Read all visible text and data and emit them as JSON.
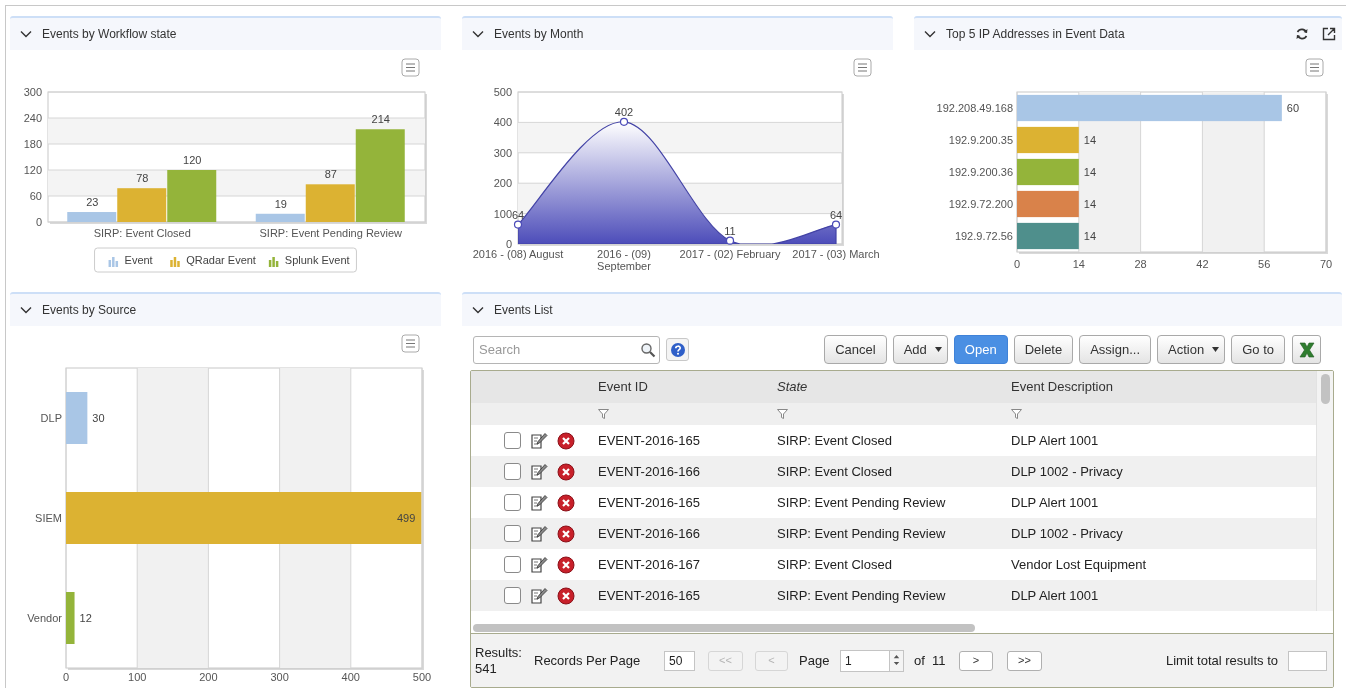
{
  "panels": [
    {
      "title": "Events by Workflow state",
      "has_actions": false,
      "chart_data": {
        "type": "bar",
        "categories": [
          "SIRP: Event Closed",
          "SIRP: Event Pending Review"
        ],
        "series": [
          {
            "name": "Event",
            "color": "#a9c6e6",
            "values": [
              23,
              19
            ]
          },
          {
            "name": "QRadar Event",
            "color": "#dcb232",
            "values": [
              78,
              87
            ]
          },
          {
            "name": "Splunk Event",
            "color": "#94b43a",
            "values": [
              120,
              214
            ]
          }
        ],
        "ylim": [
          0,
          300
        ],
        "yticks": [
          0,
          60,
          120,
          180,
          240,
          300
        ],
        "data_labels": true,
        "grid": true,
        "legend": "bottom"
      }
    },
    {
      "title": "Events by Month",
      "has_actions": false,
      "chart_data": {
        "type": "area",
        "categories": [
          "2016 - (08) August",
          "2016 - (09) September",
          "2017 - (02) February",
          "2017 - (03) March"
        ],
        "series": [
          {
            "color": "#4a4ab8",
            "values": [
              64,
              402,
              11,
              64
            ]
          }
        ],
        "ylim": [
          0,
          500
        ],
        "yticks": [
          0,
          100,
          200,
          300,
          400,
          500
        ],
        "data_labels": true,
        "grid": true
      }
    },
    {
      "title": "Top 5 IP Addresses in Event Data",
      "has_actions": true,
      "chart_data": {
        "type": "bar",
        "orientation": "horizontal",
        "categories": [
          "192.208.49.168",
          "192.9.200.35",
          "192.9.200.36",
          "192.9.72.200",
          "192.9.72.56"
        ],
        "series": [
          {
            "color": "#a9c6e6",
            "values": [
              60,
              null,
              null,
              null,
              null
            ]
          },
          {
            "color": "#dcb232",
            "values": [
              null,
              14,
              null,
              null,
              null
            ]
          },
          {
            "color": "#94b43a",
            "values": [
              null,
              null,
              14,
              null,
              null
            ]
          },
          {
            "color": "#d9824a",
            "values": [
              null,
              null,
              null,
              14,
              null
            ]
          },
          {
            "color": "#4f8f8c",
            "values": [
              null,
              null,
              null,
              null,
              14
            ]
          }
        ],
        "xlim": [
          0,
          70
        ],
        "xticks": [
          0,
          14,
          28,
          42,
          56,
          70
        ],
        "data_labels": true,
        "grid": true
      }
    },
    {
      "title": "Events by Source",
      "has_actions": false,
      "chart_data": {
        "type": "bar",
        "orientation": "horizontal",
        "categories": [
          "DLP",
          "SIEM",
          "Vendor"
        ],
        "series": [
          {
            "color": "#a9c6e6",
            "values": [
              30,
              null,
              null
            ]
          },
          {
            "color": "#dcb232",
            "values": [
              null,
              499,
              null
            ]
          },
          {
            "color": "#94b43a",
            "values": [
              null,
              null,
              12
            ]
          }
        ],
        "xlim": [
          0,
          500
        ],
        "xticks": [
          0,
          100,
          200,
          300,
          400,
          500
        ],
        "data_labels": true,
        "grid": true
      }
    }
  ],
  "events_list": {
    "title": "Events List",
    "search": {
      "placeholder": "Search"
    },
    "buttons": [
      {
        "label": "Cancel",
        "kind": "plain"
      },
      {
        "label": "Add",
        "kind": "dropdown"
      },
      {
        "label": "Open",
        "kind": "primary"
      },
      {
        "label": "Delete",
        "kind": "plain"
      },
      {
        "label": "Assign...",
        "kind": "plain"
      },
      {
        "label": "Action",
        "kind": "dropdown"
      },
      {
        "label": "Go to",
        "kind": "plain"
      }
    ],
    "columns": [
      {
        "label": "Event ID",
        "italic": false
      },
      {
        "label": "State",
        "italic": true
      },
      {
        "label": "Event Description",
        "italic": false
      }
    ],
    "rows": [
      {
        "checked": false,
        "event_id": "EVENT-2016-165",
        "state": "SIRP: Event Closed",
        "description": "DLP Alert 1001"
      },
      {
        "checked": false,
        "event_id": "EVENT-2016-166",
        "state": "SIRP: Event Closed",
        "description": "DLP 1002 - Privacy"
      },
      {
        "checked": false,
        "event_id": "EVENT-2016-165",
        "state": "SIRP: Event Pending Review",
        "description": "DLP Alert 1001"
      },
      {
        "checked": false,
        "event_id": "EVENT-2016-166",
        "state": "SIRP: Event Pending Review",
        "description": "DLP 1002 - Privacy"
      },
      {
        "checked": false,
        "event_id": "EVENT-2016-167",
        "state": "SIRP: Event Closed",
        "description": "Vendor Lost Equipment"
      },
      {
        "checked": false,
        "event_id": "EVENT-2016-165",
        "state": "SIRP: Event Pending Review",
        "description": "DLP Alert 1001"
      }
    ],
    "footer": {
      "results_label": "Results:",
      "results_count": "541",
      "records_label": "Records Per Page",
      "records_value": "50",
      "first": {
        "label": "<<",
        "disabled": true
      },
      "prev": {
        "label": "<",
        "disabled": true
      },
      "page_label": "Page",
      "page_value": "1",
      "of_label": "of",
      "page_count": "11",
      "next": {
        "label": ">",
        "disabled": false
      },
      "last": {
        "label": ">>",
        "disabled": false
      },
      "limit_label": "Limit total results to"
    }
  }
}
